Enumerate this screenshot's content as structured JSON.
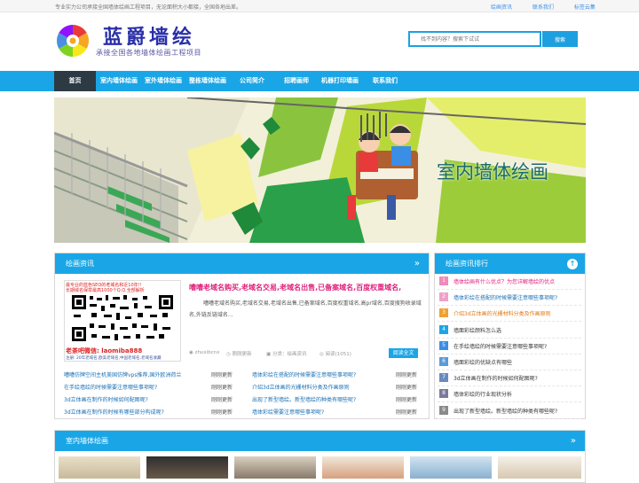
{
  "topbar": {
    "tagline": "专业实力公司承接全国墙体绘画工程项目，无论面积大小都接，全国各地出差。",
    "links": [
      "绘画资讯",
      "联系我们",
      "标签云集"
    ]
  },
  "header": {
    "logo_title": "蓝爵墙绘",
    "logo_subtitle": "承接全国各地墙体绘画工程项目",
    "search_placeholder": "找不到内容？搜索下试试",
    "search_button": "搜索"
  },
  "nav": {
    "items": [
      "首页",
      "室内墙体绘画",
      "室外墙体绘画",
      "整栋墙体绘画",
      "公司简介",
      "招聘画师",
      "机器打印墙画",
      "联系我们"
    ]
  },
  "banner": {
    "caption": "室内墙体绘画"
  },
  "news_panel": {
    "title": "绘画资讯",
    "chevron": "»",
    "featured": {
      "title": "嘈嘈老域名购买,老域名交易,老域名出售,已备案域名,百度权重域名,",
      "desc": "嘈嘈老域名购买,老域名交易,老域名出售,已备案域名,百度权重域名,高pr域名,百度搜狗收录域名,外链反链域名...",
      "author": "zhuxibcnx",
      "time": "刚刚更新",
      "category": "分类：绘画资讯",
      "views": "阅读(1051)",
      "read_more": "阅读全文",
      "qr_top": "最专业的蓝色SEO的老域名和近10年!!",
      "qr_line2": "长期域名保举最高1000个Q.Q.全部解析",
      "qr_wechat": "老茶吧微信: laomiba888",
      "qr_footer": "注册: 20年老域名,欧美老域名,中国老域名,老域名收藏"
    },
    "list_left": [
      {
        "title": "嘈嘈仿牌空间主机美国仿牌vps推荐,国外欧洲荷兰",
        "date": "刚刚更新",
        "color": "#1a6fb3"
      },
      {
        "title": "在手绘墙绘的时候需要注意哪些事项呢?",
        "date": "刚刚更新",
        "color": "#1a6fb3"
      },
      {
        "title": "3d立体画在制作的时候如何配图呢?",
        "date": "刚刚更新",
        "color": "#1a6fb3"
      },
      {
        "title": "3d立体画在制作的时候有哪些部分构成呢?",
        "date": "刚刚更新",
        "color": "#1a6fb3"
      }
    ],
    "list_right": [
      {
        "title": "墙体彩绘在搭配的时候需要注意哪些事项呢?",
        "date": "刚刚更新",
        "color": "#1a6fb3"
      },
      {
        "title": "介绍3d立体画的光栅材料分类及作画原则",
        "date": "刚刚更新",
        "color": "#1a6fb3"
      },
      {
        "title": "出现了新型墙绘。新型墙绘的种类有哪些呢?",
        "date": "刚刚更新",
        "color": "#1a6fb3"
      },
      {
        "title": "墙体彩绘需要注意哪些事项呢?",
        "date": "刚刚更新",
        "color": "#1a6fb3"
      }
    ]
  },
  "rank_panel": {
    "title": "绘画资讯排行",
    "up_icon": "↑",
    "items": [
      {
        "num": "1",
        "text": "墙体绘画有什么优点？为您详解墙绘的优点",
        "color": "#e0217b",
        "badge": "#f08ab8"
      },
      {
        "num": "2",
        "text": "墙体彩绘在搭配的时候需要注意哪些事项呢?",
        "color": "#1a6fb3",
        "badge": "#f0a0c8"
      },
      {
        "num": "3",
        "text": "介绍3d立体画的光栅材料分类及作画原则",
        "color": "#e07a10",
        "badge": "#f0a030"
      },
      {
        "num": "4",
        "text": "墙面彩绘颜料怎么选",
        "color": "#333333",
        "badge": "#1aa6e6"
      },
      {
        "num": "5",
        "text": "在手绘墙绘的时候需要注意哪些事项呢?",
        "color": "#333333",
        "badge": "#3a8ee6"
      },
      {
        "num": "6",
        "text": "墙面彩绘的优缺点有哪些",
        "color": "#333333",
        "badge": "#5a9ad8"
      },
      {
        "num": "7",
        "text": "3d立体画在制作的时候如何配图呢?",
        "color": "#333333",
        "badge": "#6a8ac0"
      },
      {
        "num": "8",
        "text": "墙体彩绘的行业现状分析",
        "color": "#333333",
        "badge": "#7a7a9a"
      },
      {
        "num": "9",
        "text": "出现了新型墙绘。新型墙绘的种类有哪些呢?",
        "color": "#333333",
        "badge": "#8a8a8a"
      }
    ]
  },
  "indoor_panel": {
    "title": "室内墙体绘画",
    "chevron": "»"
  },
  "colors": {
    "accent": "#1aa6e6",
    "nav_home": "#2c3a44",
    "link": "#3a8ee6"
  }
}
